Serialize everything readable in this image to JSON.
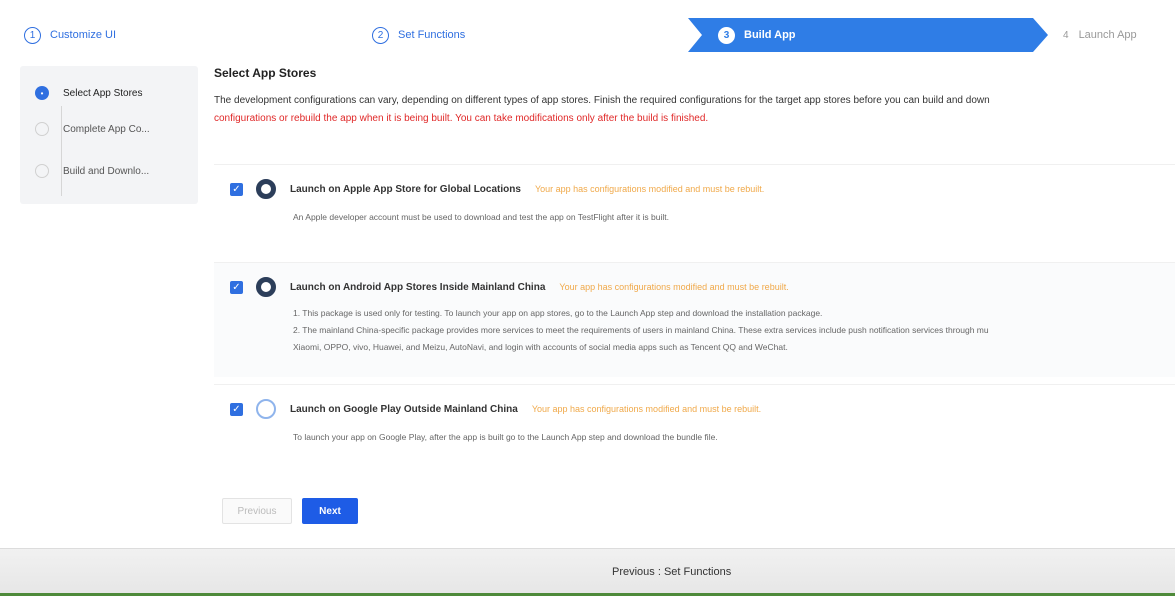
{
  "stepper": {
    "steps": [
      {
        "num": "1",
        "label": "Customize UI"
      },
      {
        "num": "2",
        "label": "Set Functions"
      },
      {
        "num": "3",
        "label": "Build App"
      },
      {
        "num": "4",
        "label": "Launch App"
      }
    ]
  },
  "sidebar": {
    "items": [
      {
        "label": "Select App Stores"
      },
      {
        "label": "Complete App Co..."
      },
      {
        "label": "Build and Downlo..."
      }
    ]
  },
  "main": {
    "title": "Select App Stores",
    "desc_line1": "The development configurations can vary, depending on different types of app stores. Finish the required configurations for the target app stores before you can build and down",
    "desc_line2": "configurations or rebuild the app when it is being built. You can take modifications only after the build is finished."
  },
  "stores": [
    {
      "name": "Launch on Apple App Store for Global Locations",
      "note": "Your app has configurations modified and must be rebuilt.",
      "desc": [
        "An Apple developer account must be used to download and test the app on TestFlight after it is built."
      ]
    },
    {
      "name": "Launch on Android App Stores Inside Mainland China",
      "note": "Your app has configurations modified and must be rebuilt.",
      "desc": [
        "1. This package is used only for testing. To launch your app on app stores, go to the Launch App step and download the installation package.",
        "2. The mainland China-specific package provides more services to meet the requirements of users in mainland China. These extra services include push notification services through mu",
        "Xiaomi, OPPO, vivo, Huawei, and Meizu, AutoNavi, and login with accounts of social media apps such as Tencent QQ and WeChat."
      ]
    },
    {
      "name": "Launch on Google Play Outside Mainland China",
      "note": "Your app has configurations modified and must be rebuilt.",
      "desc": [
        "To launch your app on Google Play, after the app is built go to the Launch App step and download the bundle file."
      ]
    }
  ],
  "buttons": {
    "previous": "Previous",
    "next": "Next"
  },
  "footer": {
    "link": "Previous : Set Functions"
  },
  "colors": {
    "accent": "#2f6fe0",
    "warning": "#e02828",
    "note": "#f0a94a"
  }
}
